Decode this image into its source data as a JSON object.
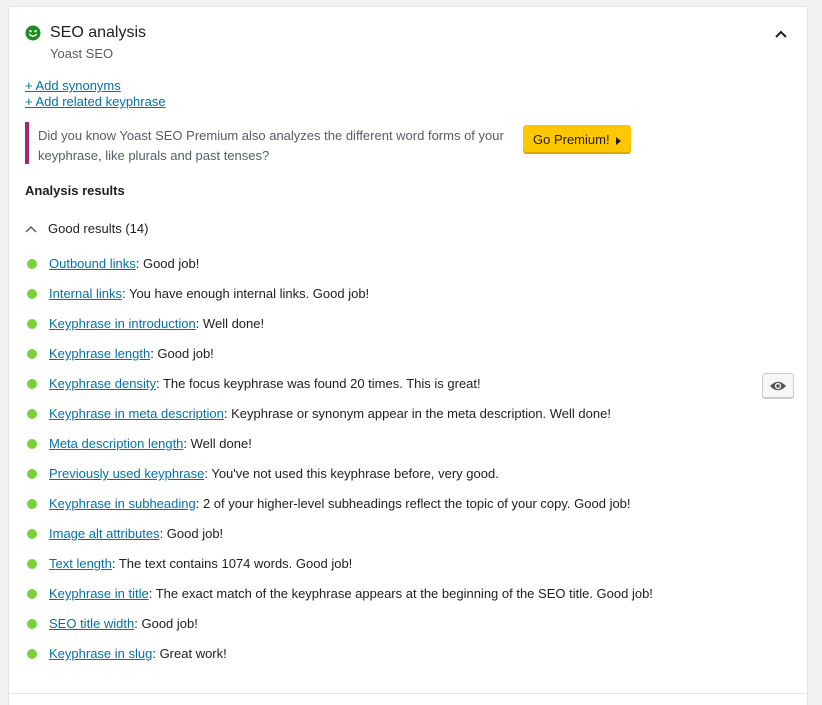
{
  "header": {
    "title": "SEO analysis",
    "subtitle": "Yoast SEO",
    "status_color": "#1e8c1e"
  },
  "links": {
    "add_synonyms": "+ Add synonyms",
    "add_related": "+ Add related keyphrase"
  },
  "notice": {
    "text": "Did you know Yoast SEO Premium also analyzes the different word forms of your keyphrase, like plurals and past tenses?",
    "button_label": "Go Premium!",
    "accent": "#a4286a"
  },
  "analysis": {
    "heading": "Analysis results",
    "good_results_label": "Good results (14)",
    "bullet_color": "#7ad03a",
    "results": [
      {
        "link": "Outbound links",
        "text": ": Good job!"
      },
      {
        "link": "Internal links",
        "text": ": You have enough internal links. Good job!"
      },
      {
        "link": "Keyphrase in introduction",
        "text": ": Well done!"
      },
      {
        "link": "Keyphrase length",
        "text": ": Good job!"
      },
      {
        "link": "Keyphrase density",
        "text": ": The focus keyphrase was found 20 times. This is great!"
      },
      {
        "link": "Keyphrase in meta description",
        "text": ": Keyphrase or synonym appear in the meta description. Well done!"
      },
      {
        "link": "Meta description length",
        "text": ": Well done!"
      },
      {
        "link": "Previously used keyphrase",
        "text": ": You've not used this keyphrase before, very good."
      },
      {
        "link": "Keyphrase in subheading",
        "text": ": 2 of your higher-level subheadings reflect the topic of your copy. Good job!"
      },
      {
        "link": "Image alt attributes",
        "text": ": Good job!"
      },
      {
        "link": "Text length",
        "text": ": The text contains 1074 words. Good job!"
      },
      {
        "link": "Keyphrase in title",
        "text": ": The exact match of the keyphrase appears at the beginning of the SEO title. Good job!"
      },
      {
        "link": "SEO title width",
        "text": ": Good job!"
      },
      {
        "link": "Keyphrase in slug",
        "text": ": Great work!"
      }
    ]
  },
  "icons": {
    "status": "smiley-icon",
    "collapse": "chevron-up-icon",
    "toggle": "chevron-up-icon",
    "highlight": "eye-icon"
  }
}
